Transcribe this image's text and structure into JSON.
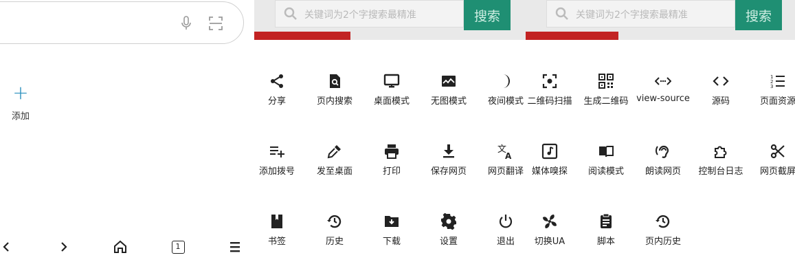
{
  "search": {
    "placeholder": ""
  },
  "left": {
    "add_label": "添加",
    "page_count": "1"
  },
  "web": {
    "search_placeholder": "关键词为2个字搜索最精准",
    "search_button": "搜索"
  },
  "menu": {
    "row1": [
      "分享",
      "页内搜索",
      "桌面模式",
      "无图模式",
      "夜间模式",
      "二维码扫描",
      "生成二维码",
      "view-source",
      "源码",
      "页面资源"
    ],
    "row2": [
      "添加拨号",
      "发至桌面",
      "打印",
      "保存网页",
      "网页翻译",
      "媒体嗅探",
      "阅读模式",
      "朗读网页",
      "控制台日志",
      "网页截屏"
    ],
    "row3": [
      "书签",
      "历史",
      "下载",
      "设置",
      "退出",
      "切换UA",
      "脚本",
      "页内历史"
    ]
  },
  "colors": {
    "accent": "#2a8fbd",
    "web_button": "#1f8f73",
    "web_red": "#c22323"
  }
}
